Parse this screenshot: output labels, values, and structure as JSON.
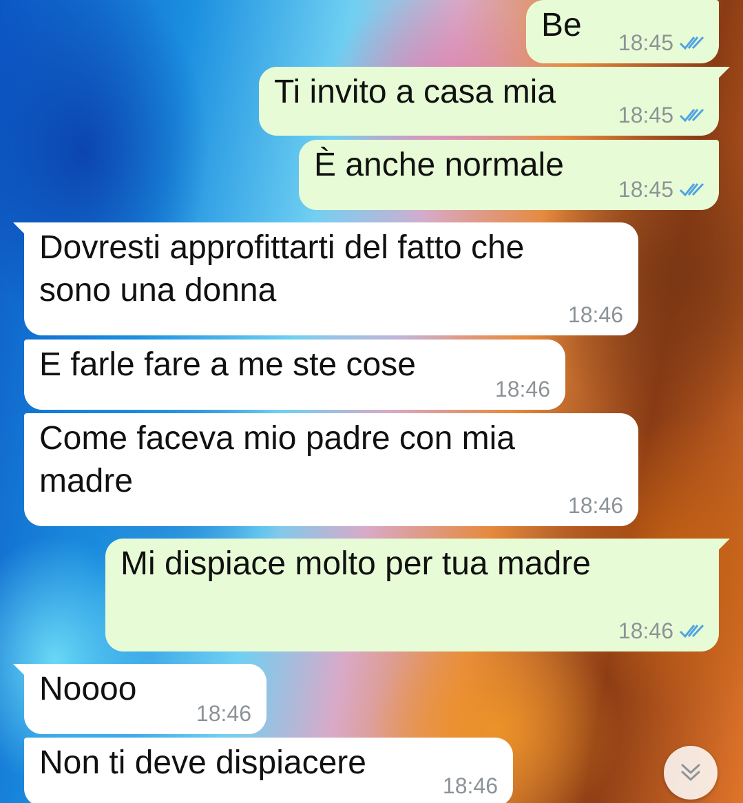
{
  "messages": [
    {
      "direction": "out",
      "text": "Be",
      "time": "18:45",
      "status": "read-double-check-icon"
    },
    {
      "direction": "out",
      "text": "Ti invito a casa mia",
      "time": "18:45",
      "status": "read-double-check-icon"
    },
    {
      "direction": "out",
      "text": "È anche normale",
      "time": "18:45",
      "status": "read-double-check-icon"
    },
    {
      "direction": "in",
      "text": "Dovresti approfittarti del fatto che\nsono una donna",
      "time": "18:46"
    },
    {
      "direction": "in",
      "text": "E farle fare a me ste cose",
      "time": "18:46"
    },
    {
      "direction": "in",
      "text": "Come faceva mio padre con mia\nmadre",
      "time": "18:46"
    },
    {
      "direction": "out",
      "text": "Mi dispiace molto per tua madre",
      "time": "18:46",
      "status": "read-double-check-icon"
    },
    {
      "direction": "in",
      "text": "Noooo",
      "time": "18:46"
    },
    {
      "direction": "in",
      "text": "Non ti deve dispiacere",
      "time": "18:46"
    }
  ],
  "colors": {
    "outgoing_bubble": "#e7fcd6",
    "incoming_bubble": "#ffffff",
    "timestamp": "#8c9397",
    "read_ticks": "#4fa3e0"
  },
  "scroll_button": {
    "icon": "double-chevron-down-icon"
  }
}
